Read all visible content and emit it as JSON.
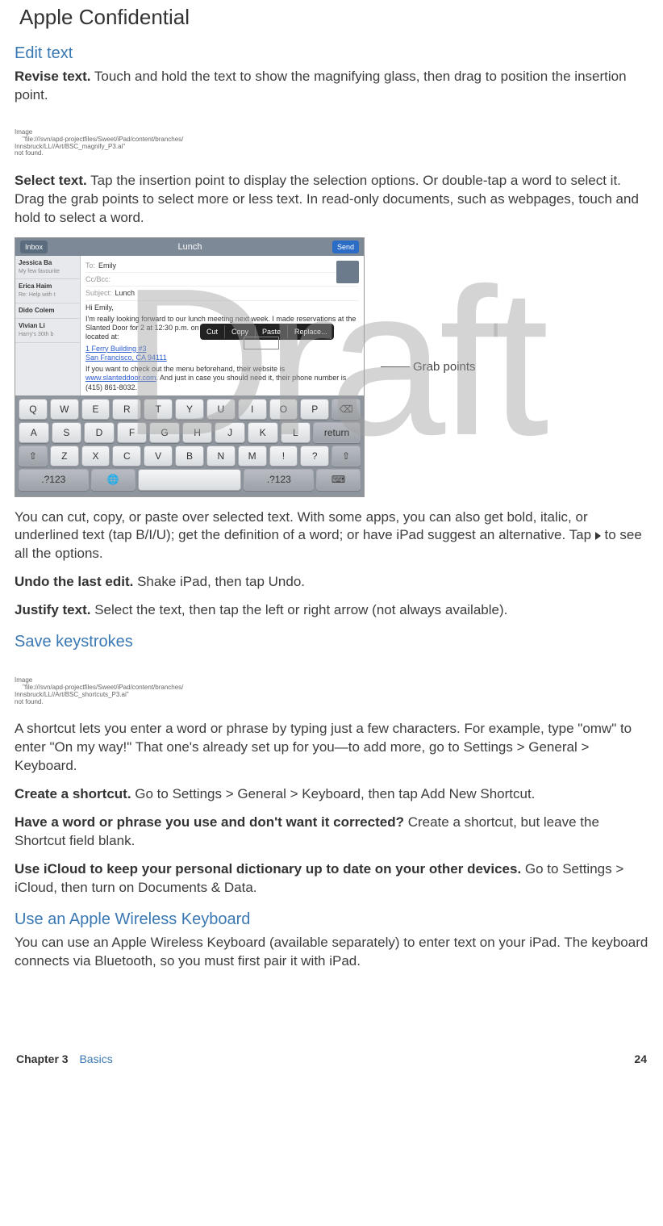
{
  "header": {
    "confidential": "Apple Confidential"
  },
  "watermark": "Draft",
  "sections": {
    "edit": {
      "title": "Edit text",
      "revise_b": "Revise text.",
      "revise_t": " Touch and hold the text to show the magnifying glass, then drag to position the insertion point.",
      "select_b": "Select text.",
      "select_t": " Tap the insertion point to display the selection options. Or double-tap a word to select it. Drag the grab points to select more or less text. In read-only documents, such as webpages, touch and hold to select a word.",
      "para_options": "You can cut, copy, or paste over selected text. With some apps, you can also get bold, italic, or underlined text (tap B/I/U); get the definition of a word; or have iPad suggest an alternative. Tap ",
      "para_options_tail": " to see all the options.",
      "undo_b": "Undo the last edit.",
      "undo_t": " Shake iPad, then tap Undo.",
      "justify_b": "Justify text.",
      "justify_t": " Select the text, then tap the left or right arrow (not always available)."
    },
    "save": {
      "title": "Save keystrokes",
      "para1": "A shortcut lets you enter a word or phrase by typing just a few characters. For example, type \"omw\" to enter \"On my way!\" That one's already set up for you—to add more, go to Settings > General > Keyboard.",
      "create_b": "Create a shortcut.",
      "create_t": " Go to Settings > General > Keyboard, then tap Add New Shortcut.",
      "have_b": "Have a word or phrase you use and don't want it corrected?",
      "have_t": " Create a shortcut, but leave the Shortcut field blank.",
      "icloud_b": "Use iCloud to keep your personal dictionary up to date on your other devices.",
      "icloud_t": " Go to Settings > iCloud, then turn on Documents & Data."
    },
    "wireless": {
      "title": "Use an Apple Wireless Keyboard",
      "para": "You can use an Apple Wireless Keyboard (available separately) to enter text on your iPad. The keyboard connects via Bluetooth, so you must first pair it with iPad."
    }
  },
  "missing_images": {
    "magnify": {
      "l1": "Image",
      "l2": "\"file:///svn/apd-projectfiles/Sweet/iPad/content/branches/",
      "l3": "Innsbruck/LL//Art/BSC_magnify_P3.ai\"",
      "l4": "not found."
    },
    "shortcuts": {
      "l1": "Image",
      "l2": "\"file:///svn/apd-projectfiles/Sweet/iPad/content/branches/",
      "l3": "Innsbruck/LL//Art/BSC_shortcuts_P3.ai\"",
      "l4": "not found."
    }
  },
  "figure": {
    "caption": "Grab points",
    "topbar": {
      "left": "Inbox",
      "title": "Lunch",
      "right": "Send"
    },
    "sidebar": {
      "items": [
        {
          "name": "Jessica Ba",
          "sub": "My few favourite"
        },
        {
          "name": "Erica Haim",
          "sub": "Re: Help with t"
        },
        {
          "name": "Dido Colem",
          "sub": ""
        },
        {
          "name": "Vivian Li",
          "sub": "Harry's 30th b"
        }
      ]
    },
    "compose": {
      "to_lab": "To:",
      "to_val": "Emily",
      "cc_lab": "Cc/Bcc:",
      "cc_val": "",
      "subj_lab": "Subject:",
      "subj_val": "Lunch",
      "greet": "Hi Emily,",
      "body1": "I'm really looking forward to our lunch meeting next week. I made reservations at the Slanted Door for 2 at 12:30 p.m. on Friday, October 7, 2011. The restaurant is located at:",
      "addr1": "1 Ferry Building #3",
      "addr2": "San Francisco, CA 94111",
      "body2a": "If you want to check out the menu beforehand, their website is ",
      "body2link": "www.slanteddoor.com",
      "body2b": ". And just in case you should need it, their phone number is (415) 861-8032.",
      "popup": [
        "Cut",
        "Copy",
        "Paste",
        "Replace..."
      ]
    },
    "keyboard": {
      "row1": [
        "Q",
        "W",
        "E",
        "R",
        "T",
        "Y",
        "U",
        "I",
        "O",
        "P",
        "⌫"
      ],
      "row2": [
        "A",
        "S",
        "D",
        "F",
        "G",
        "H",
        "J",
        "K",
        "L",
        "return"
      ],
      "row3": [
        "⇧",
        "Z",
        "X",
        "C",
        "V",
        "B",
        "N",
        "M",
        "!",
        ",",
        "?",
        ".",
        "⇧"
      ],
      "row4": [
        ".?123",
        "🌐",
        "",
        "",
        ".?123",
        "⌨"
      ]
    }
  },
  "footer": {
    "chapter_label": "Chapter  3",
    "chapter_title": "Basics",
    "page": "24"
  }
}
